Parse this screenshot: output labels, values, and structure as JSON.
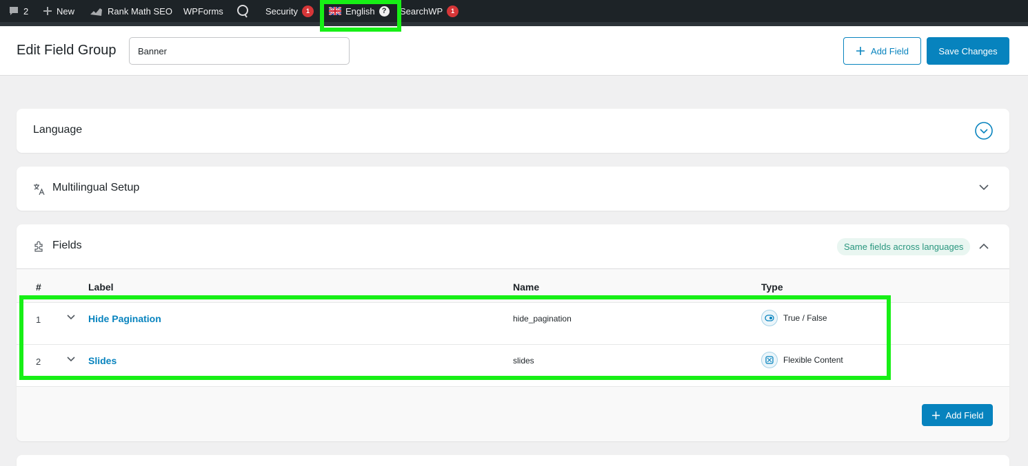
{
  "adminbar": {
    "comments_count": "2",
    "new_label": "New",
    "rankmath_label": "Rank Math SEO",
    "wpforms_label": "WPForms",
    "security_label": "Security",
    "security_badge": "1",
    "language_label": "English",
    "help_glyph": "?",
    "searchwp_label": "SearchWP",
    "searchwp_badge": "1"
  },
  "header": {
    "title": "Edit Field Group",
    "group_title_value": "Banner",
    "add_field_label": "Add Field",
    "save_label": "Save Changes"
  },
  "panels": {
    "language": {
      "title": "Language"
    },
    "multilingual": {
      "title": "Multilingual Setup"
    },
    "fields": {
      "title": "Fields",
      "badge": "Same fields across languages",
      "columns": {
        "num": "#",
        "label": "Label",
        "name": "Name",
        "type": "Type"
      },
      "rows": [
        {
          "num": "1",
          "label": "Hide Pagination",
          "name": "hide_pagination",
          "type": "True / False",
          "type_icon": "toggle-icon"
        },
        {
          "num": "2",
          "label": "Slides",
          "name": "slides",
          "type": "Flexible Content",
          "type_icon": "flexible-content-icon"
        }
      ],
      "add_field_label": "Add Field"
    }
  },
  "colors": {
    "accent": "#0783be",
    "highlight": "#17ef16",
    "badge_red": "#d63638",
    "adminbar_bg": "#1d2327"
  }
}
